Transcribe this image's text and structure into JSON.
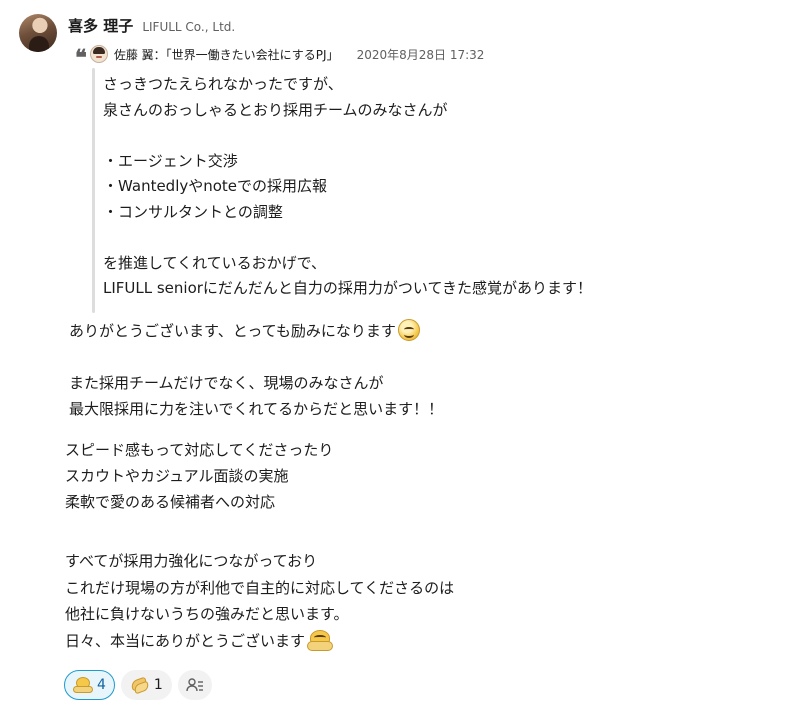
{
  "message": {
    "author": "喜多 理子",
    "company": "LIFULL Co., Ltd."
  },
  "quote": {
    "name": "佐藤 翼",
    "channel": "：「世界一働きたい会社にするPJ」",
    "date": "2020年8月28日 17:32",
    "lines": [
      "さっきつたえられなかったですが、",
      "泉さんのおっしゃるとおり採用チームのみなさんが",
      "",
      "・エージェント交渉",
      "・Wantedlyやnoteでの採用広報",
      "・コンサルタントとの調整",
      "",
      "を推進してくれているおかげで、",
      "LIFULL seniorにだんだんと自力の採用力がついてきた感覚があります！"
    ]
  },
  "body": {
    "p1": "ありがとうございます、とっても励みになります",
    "p2": [
      "また採用チームだけでなく、現場のみなさんが",
      "最大限採用に力を注いでくれてるからだと思います！！"
    ],
    "p3": [
      "スピード感もって対応してくださったり",
      "スカウトやカジュアル面談の実施",
      "柔軟で愛のある候補者への対応"
    ],
    "p4": [
      "すべてが採用力強化につながっており",
      "これだけ現場の方が利他で自主的に対応してくださるのは",
      "他社に負けないうちの強みだと思います。",
      "日々、本当にありがとうございます"
    ]
  },
  "reactions": [
    {
      "icon": "bow-icon",
      "count": "4",
      "active": true
    },
    {
      "icon": "clap-icon",
      "count": "1",
      "active": false
    }
  ],
  "colors": {
    "accent": "#1d9bd1",
    "accent_bg": "#e8f5fa",
    "text": "#1d1c1d",
    "muted": "#616061"
  }
}
